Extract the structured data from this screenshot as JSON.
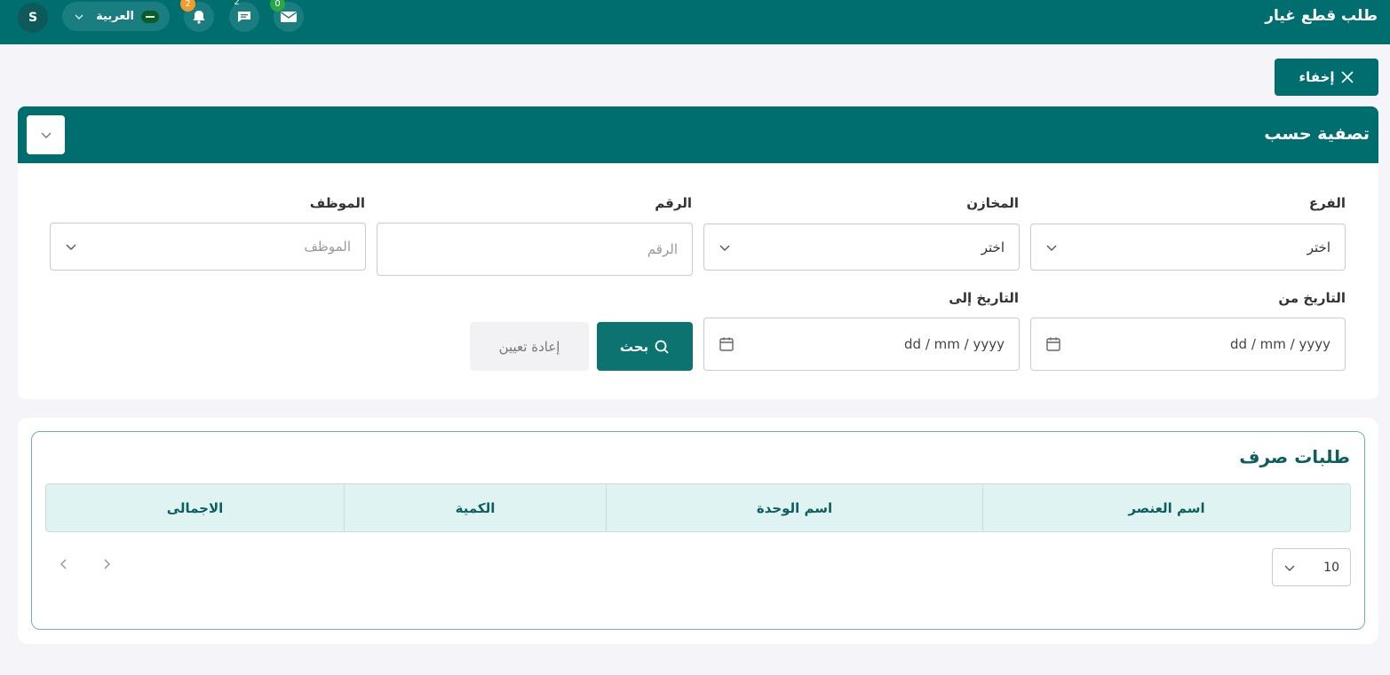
{
  "header": {
    "title": "طلب قطع غيار",
    "avatar_initial": "S",
    "language_label": "العربية",
    "notifications_count": "2",
    "messages_count": "2",
    "mail_count": "0"
  },
  "toolbar": {
    "hide_label": "إخفاء"
  },
  "filter": {
    "title": "تصفية حسب",
    "branch_label": "الفرع",
    "branch_value": "اختر",
    "stores_label": "المخازن",
    "stores_value": "اختر",
    "number_label": "الرقم",
    "number_placeholder": "الرقم",
    "employee_label": "الموظف",
    "employee_placeholder": "الموظف",
    "date_from_label": "التاريخ من",
    "date_from_value": "dd / mm / yyyy",
    "date_to_label": "التاريخ إلى",
    "date_to_value": "dd / mm / yyyy",
    "search_label": "بحث",
    "reset_label": "إعادة تعيين"
  },
  "table": {
    "title": "طلبات صرف",
    "columns": [
      "اسم العنصر",
      "اسم الوحدة",
      "الكمية",
      "الاجمالى"
    ],
    "page_size": "10"
  },
  "colors": {
    "primary": "#006d6f",
    "header_bg": "#dff3f3",
    "accent_text": "#0d5f5d"
  }
}
